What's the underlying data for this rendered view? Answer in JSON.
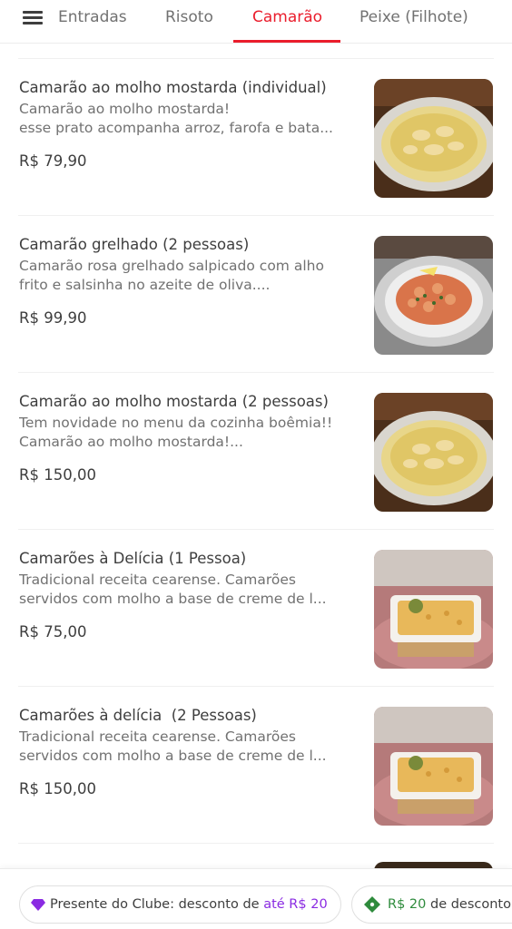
{
  "header": {
    "menu_icon": "hamburger-menu-icon",
    "tabs": [
      {
        "label": "Entradas"
      },
      {
        "label": "Risoto"
      },
      {
        "label": "Camarão"
      },
      {
        "label": "Peixe (Filhote)"
      }
    ],
    "active_tab": "Camarão",
    "accent_color": "#ea1d2c"
  },
  "items": [
    {
      "title": "Camarão ao molho mostarda (individual)",
      "desc_lines": [
        "Camarão ao molho mostarda!",
        "esse prato acompanha arroz, farofa e bata..."
      ],
      "price": "R$ 79,90",
      "image": "mustard-shrimp-photo"
    },
    {
      "title": "Camarão grelhado (2 pessoas)",
      "desc_lines": [
        "Camarão rosa grelhado salpicado com alho",
        "frito e salsinha no azeite de oliva...."
      ],
      "price": "R$ 99,90",
      "image": "grilled-shrimp-photo"
    },
    {
      "title": "Camarão ao molho mostarda (2 pessoas)",
      "desc_lines": [
        "Tem novidade no menu da cozinha boêmia!!",
        "Camarão ao molho mostarda!..."
      ],
      "price": "R$ 150,00",
      "image": "mustard-shrimp-photo"
    },
    {
      "title": "Camarões à Delícia (1 Pessoa)",
      "desc_lines": [
        "Tradicional receita cearense. Camarões",
        "servidos com molho a base de creme de l..."
      ],
      "price": "R$ 75,00",
      "image": "shrimp-gratin-photo"
    },
    {
      "title": "Camarões à delícia  (2 Pessoas)",
      "desc_lines": [
        "Tradicional receita cearense. Camarões",
        "servidos com molho a base de creme de l..."
      ],
      "price": "R$ 150,00",
      "image": "shrimp-gratin-photo"
    }
  ],
  "footer": {
    "club": {
      "prefix": "Presente do Clube: desconto de ",
      "highlight": "até R$ 20",
      "icon": "diamond-icon",
      "color": "#8a2be2"
    },
    "coupon": {
      "highlight": "R$ 20",
      "suffix": " de desconto",
      "icon": "ticket-icon",
      "color": "#2e8b3c"
    }
  }
}
